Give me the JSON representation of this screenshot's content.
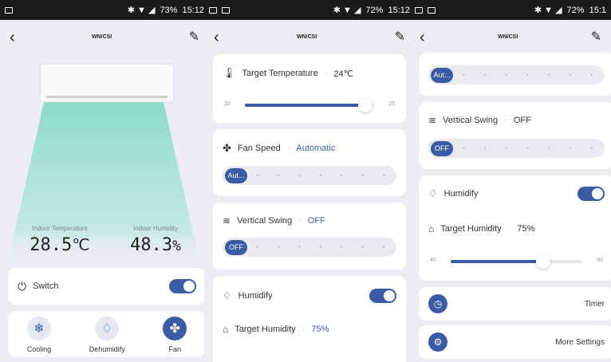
{
  "status1": {
    "time": "15:12",
    "battery": "73%"
  },
  "status2": {
    "time": "15:12",
    "battery": "72%"
  },
  "status3": {
    "time": "15:1",
    "battery": "72%"
  },
  "device_name": "WN/CSI",
  "home": {
    "indoor_temp_label": "Indoor Temperature",
    "indoor_temp_value": "28.5",
    "indoor_temp_unit": "℃",
    "indoor_humidity_label": "Indoor Humidity",
    "indoor_humidity_value": "48.3",
    "indoor_humidity_unit": "%",
    "switch_label": "Switch",
    "switch_on": true,
    "modes": [
      {
        "label": "Cooling",
        "icon": "snowflake-icon",
        "active": false
      },
      {
        "label": "Dehumidify",
        "icon": "droplet-icon",
        "active": false
      },
      {
        "label": "Fan",
        "icon": "fan-icon",
        "active": true
      }
    ]
  },
  "settings": {
    "target_temp": {
      "label": "Target Temperature",
      "value": "24℃",
      "min": "10",
      "max": "25",
      "current": 24
    },
    "fan_speed": {
      "label": "Fan Speed",
      "value": "Automatic",
      "selected": "Aut..."
    },
    "vertical_swing": {
      "label": "Vertical Swing",
      "value": "OFF",
      "selected": "OFF"
    },
    "humidify": {
      "label": "Humidify",
      "on": true
    },
    "target_humidity": {
      "label": "Target Humidity",
      "value": "75%",
      "min": "40",
      "max": "90",
      "current": 75
    },
    "timer_label": "Timer",
    "more_label": "More Settings"
  },
  "separator": "·",
  "colors": {
    "accent": "#3b5ba5",
    "airflow": "#7fd9c0"
  }
}
